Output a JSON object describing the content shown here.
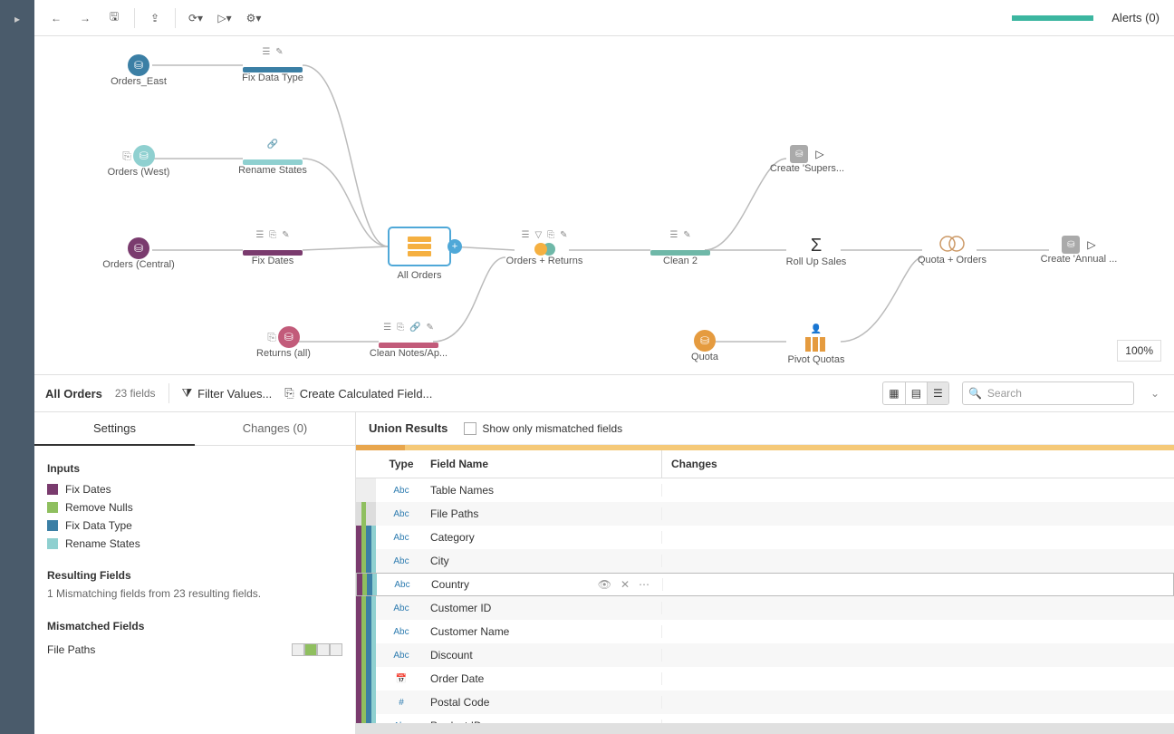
{
  "toolbar": {
    "alerts": "Alerts (0)"
  },
  "zoom": "100%",
  "nodes": {
    "orders_east": "Orders_East",
    "fix_data_type": "Fix Data Type",
    "orders_west": "Orders (West)",
    "rename_states": "Rename States",
    "orders_central": "Orders (Central)",
    "fix_dates": "Fix Dates",
    "all_orders": "All Orders",
    "orders_returns": "Orders + Returns",
    "clean2": "Clean 2",
    "rollup": "Roll Up Sales",
    "quota_orders": "Quota + Orders",
    "create_annual": "Create 'Annual ...",
    "create_supers": "Create 'Supers...",
    "returns_all": "Returns (all)",
    "clean_notes": "Clean Notes/Ap...",
    "quota": "Quota",
    "pivot_quotas": "Pivot Quotas"
  },
  "bottom": {
    "title": "All Orders",
    "fields": "23 fields",
    "filter": "Filter Values...",
    "calc": "Create Calculated Field...",
    "search": "Search"
  },
  "left": {
    "tab_settings": "Settings",
    "tab_changes": "Changes (0)",
    "inputs_h": "Inputs",
    "inputs": [
      {
        "color": "#7a3b6e",
        "label": "Fix Dates"
      },
      {
        "color": "#8fbf5f",
        "label": "Remove Nulls"
      },
      {
        "color": "#3b7fa5",
        "label": "Fix Data Type"
      },
      {
        "color": "#8fd0d0",
        "label": "Rename States"
      }
    ],
    "resulting_h": "Resulting Fields",
    "resulting_sub": "1 Mismatching fields from 23 resulting fields.",
    "mismatched_h": "Mismatched Fields",
    "mismatch_item": "File Paths"
  },
  "union": {
    "title": "Union Results",
    "show_mismatch": "Show only mismatched fields",
    "th_type": "Type",
    "th_name": "Field Name",
    "th_changes": "Changes"
  },
  "rows": [
    {
      "type": "Abc",
      "name": "Table Names",
      "srcs": [
        "#eee"
      ],
      "typeColor": "#2e7cb0"
    },
    {
      "type": "Abc",
      "name": "File Paths",
      "srcs": [
        "#ddd",
        "#8fbf5f",
        "#ddd",
        "#ddd"
      ],
      "typeColor": "#2e7cb0"
    },
    {
      "type": "Abc",
      "name": "Category",
      "srcs": [
        "#7a3b6e",
        "#8fbf5f",
        "#3b7fa5",
        "#8fd0d0"
      ],
      "typeColor": "#2e7cb0"
    },
    {
      "type": "Abc",
      "name": "City",
      "srcs": [
        "#7a3b6e",
        "#8fbf5f",
        "#3b7fa5",
        "#8fd0d0"
      ],
      "typeColor": "#2e7cb0"
    },
    {
      "type": "Abc",
      "name": "Country",
      "srcs": [
        "#7a3b6e",
        "#8fbf5f",
        "#3b7fa5",
        "#8fd0d0"
      ],
      "hover": true,
      "typeColor": "#2e7cb0"
    },
    {
      "type": "Abc",
      "name": "Customer ID",
      "srcs": [
        "#7a3b6e",
        "#8fbf5f",
        "#3b7fa5",
        "#8fd0d0"
      ],
      "typeColor": "#2e7cb0"
    },
    {
      "type": "Abc",
      "name": "Customer Name",
      "srcs": [
        "#7a3b6e",
        "#8fbf5f",
        "#3b7fa5",
        "#8fd0d0"
      ],
      "typeColor": "#2e7cb0"
    },
    {
      "type": "Abc",
      "name": "Discount",
      "srcs": [
        "#7a3b6e",
        "#8fbf5f",
        "#3b7fa5",
        "#8fd0d0"
      ],
      "typeColor": "#2e7cb0"
    },
    {
      "type": "date",
      "name": "Order Date",
      "srcs": [
        "#7a3b6e",
        "#8fbf5f",
        "#3b7fa5",
        "#8fd0d0"
      ],
      "typeColor": "#2e7cb0"
    },
    {
      "type": "#",
      "name": "Postal Code",
      "srcs": [
        "#7a3b6e",
        "#8fbf5f",
        "#3b7fa5",
        "#8fd0d0"
      ],
      "typeColor": "#2e7cb0"
    },
    {
      "type": "Abc",
      "name": "Product ID",
      "srcs": [
        "#7a3b6e",
        "#8fbf5f",
        "#3b7fa5",
        "#8fd0d0"
      ],
      "typeColor": "#2e7cb0"
    }
  ]
}
